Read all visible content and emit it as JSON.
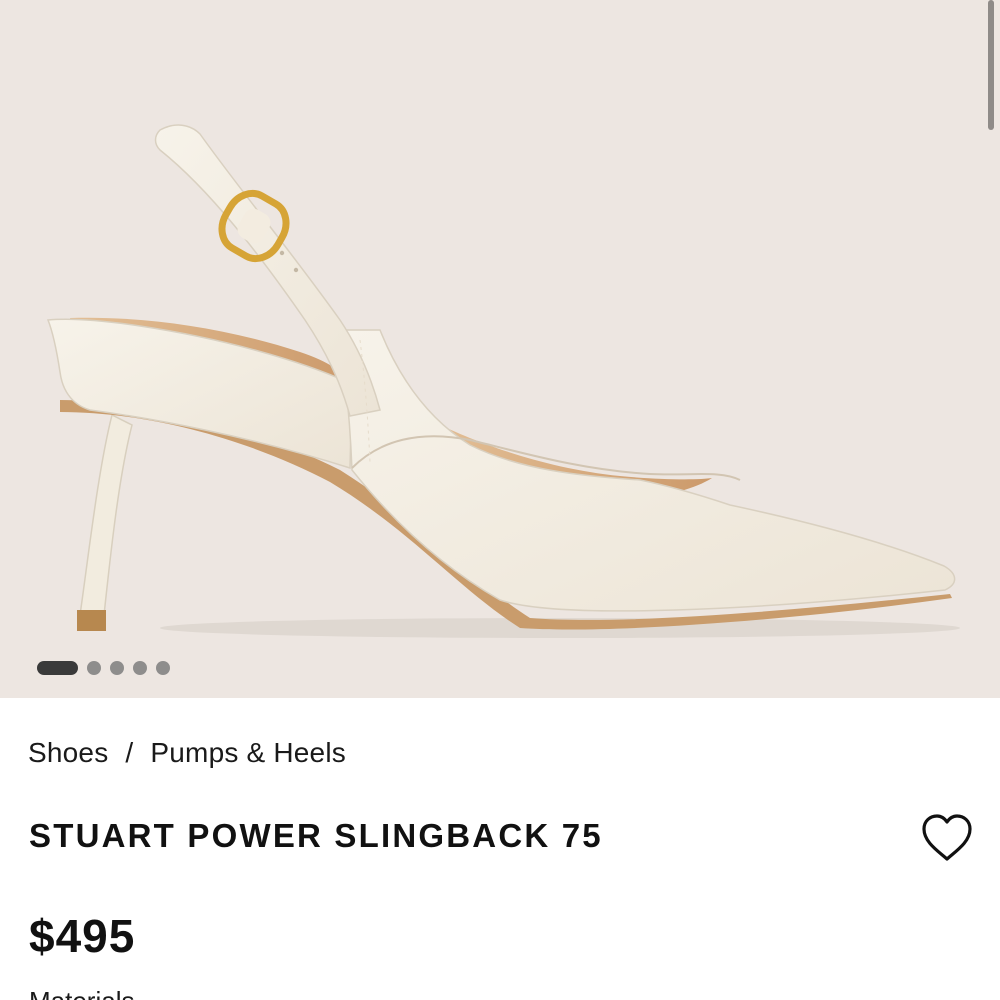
{
  "gallery": {
    "image_alt": "Ivory pointed-toe slingback pump with gold buckle",
    "slides_total": 5,
    "active_slide": 1
  },
  "breadcrumb": {
    "items": [
      "Shoes",
      "Pumps & Heels"
    ],
    "separator": "/"
  },
  "product": {
    "title": "STUART POWER SLINGBACK 75",
    "price": "$495",
    "next_section_label": "Materials"
  },
  "icons": {
    "wishlist": "heart-outline-icon"
  },
  "colors": {
    "hero_background": "#ede6e1",
    "text": "#111111",
    "dot_active": "#3a3a3a",
    "dot_inactive": "#8e8d8c"
  }
}
